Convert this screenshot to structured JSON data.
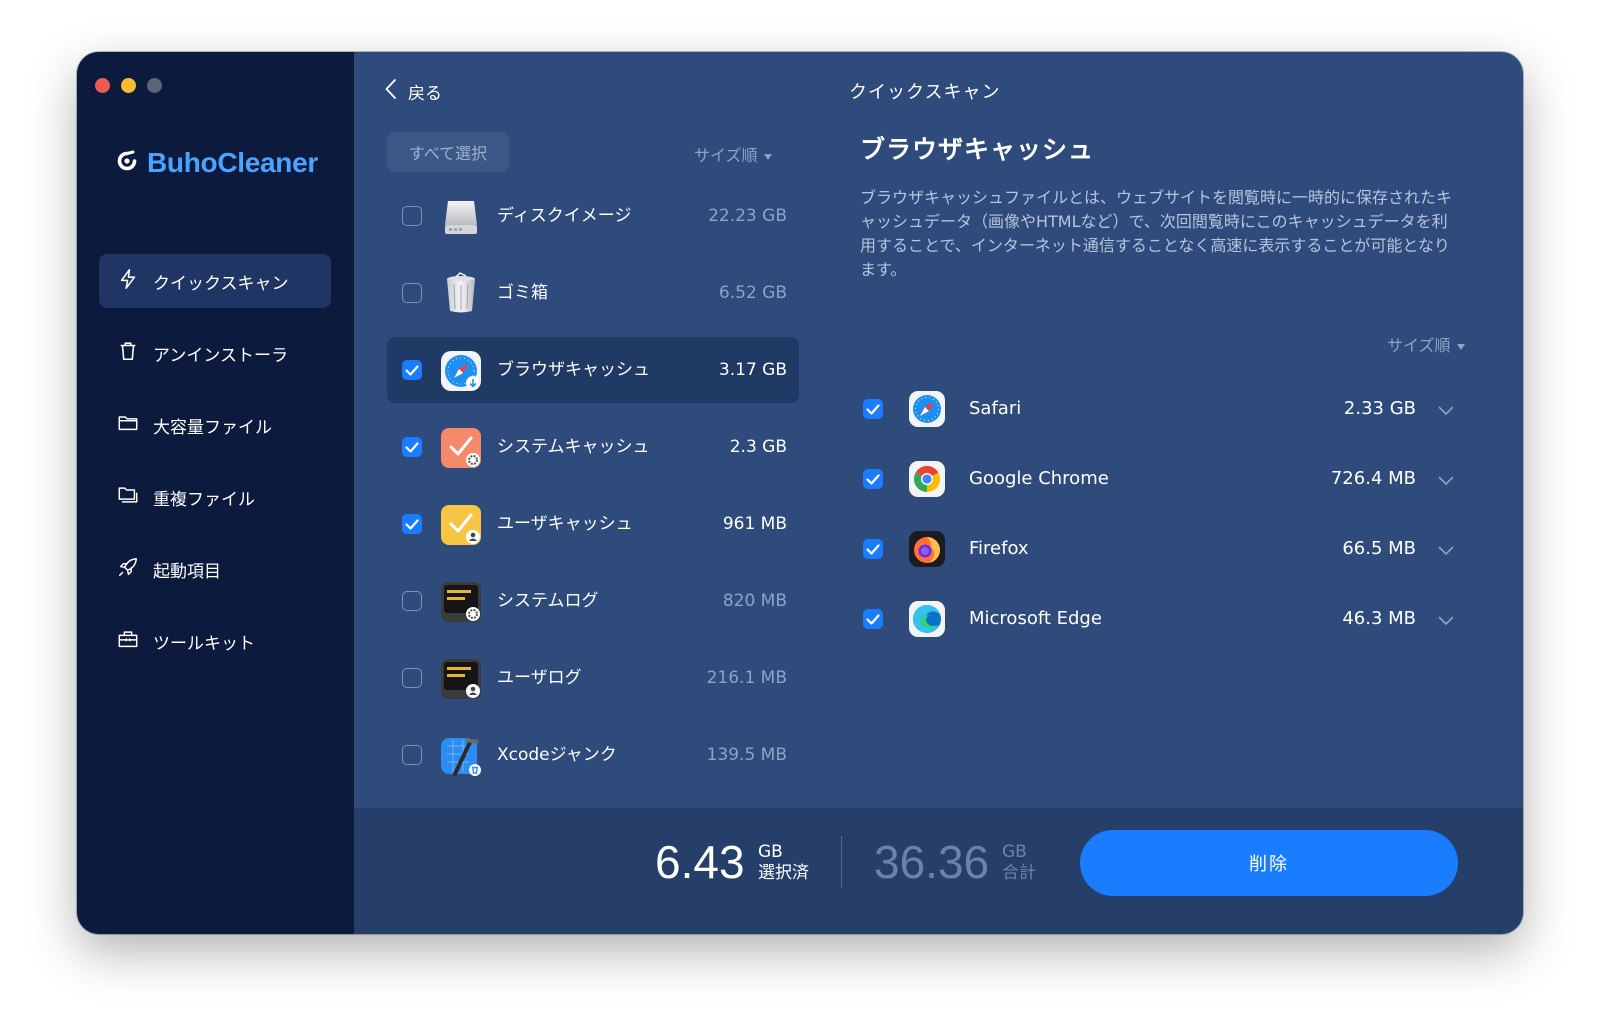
{
  "app": {
    "name": "BuhoCleaner"
  },
  "colors": {
    "accent": "#1a7cff",
    "brand": "#4aa3ff",
    "sidebar_bg": "#0c1a3d",
    "main_bg": "#2e4b7c"
  },
  "sidebar": {
    "items": [
      {
        "label": "クイックスキャン",
        "icon": "bolt-icon",
        "active": true
      },
      {
        "label": "アンインストーラ",
        "icon": "trash-icon",
        "active": false
      },
      {
        "label": "大容量ファイル",
        "icon": "folder-icon",
        "active": false
      },
      {
        "label": "重複ファイル",
        "icon": "duplicate-folder-icon",
        "active": false
      },
      {
        "label": "起動項目",
        "icon": "rocket-icon",
        "active": false
      },
      {
        "label": "ツールキット",
        "icon": "toolbox-icon",
        "active": false
      }
    ]
  },
  "header": {
    "back_label": "戻る",
    "title": "クイックスキャン"
  },
  "list": {
    "select_all_label": "すべて選択",
    "sort_label": "サイズ順",
    "categories": [
      {
        "label": "ディスクイメージ",
        "size": "22.23 GB",
        "checked": false,
        "icon": "disk-image-icon"
      },
      {
        "label": "ゴミ箱",
        "size": "6.52 GB",
        "checked": false,
        "icon": "trash-can-icon"
      },
      {
        "label": "ブラウザキャッシュ",
        "size": "3.17 GB",
        "checked": true,
        "selected": true,
        "icon": "browser-cache-icon"
      },
      {
        "label": "システムキャッシュ",
        "size": "2.3 GB",
        "checked": true,
        "icon": "system-cache-icon"
      },
      {
        "label": "ユーザキャッシュ",
        "size": "961 MB",
        "checked": true,
        "icon": "user-cache-icon"
      },
      {
        "label": "システムログ",
        "size": "820 MB",
        "checked": false,
        "icon": "system-log-icon"
      },
      {
        "label": "ユーザログ",
        "size": "216.1 MB",
        "checked": false,
        "icon": "user-log-icon"
      },
      {
        "label": "Xcodeジャンク",
        "size": "139.5 MB",
        "checked": false,
        "icon": "xcode-icon"
      }
    ]
  },
  "detail": {
    "title": "ブラウザキャッシュ",
    "description": "ブラウザキャッシュファイルとは、ウェブサイトを閲覧時に一時的に保存されたキャッシュデータ（画像やHTMLなど）で、次回閲覧時にこのキャッシュデータを利用することで、インターネット通信することなく高速に表示することが可能となります。",
    "sort_label": "サイズ順",
    "browsers": [
      {
        "name": "Safari",
        "size": "2.33 GB",
        "checked": true,
        "icon": "safari-icon"
      },
      {
        "name": "Google Chrome",
        "size": "726.4 MB",
        "checked": true,
        "icon": "chrome-icon"
      },
      {
        "name": "Firefox",
        "size": "66.5 MB",
        "checked": true,
        "icon": "firefox-icon"
      },
      {
        "name": "Microsoft Edge",
        "size": "46.3 MB",
        "checked": true,
        "icon": "edge-icon"
      }
    ]
  },
  "footer": {
    "selected_value": "6.43",
    "selected_unit": "GB",
    "selected_label": "選択済",
    "total_value": "36.36",
    "total_unit": "GB",
    "total_label": "合計",
    "delete_label": "削除"
  }
}
